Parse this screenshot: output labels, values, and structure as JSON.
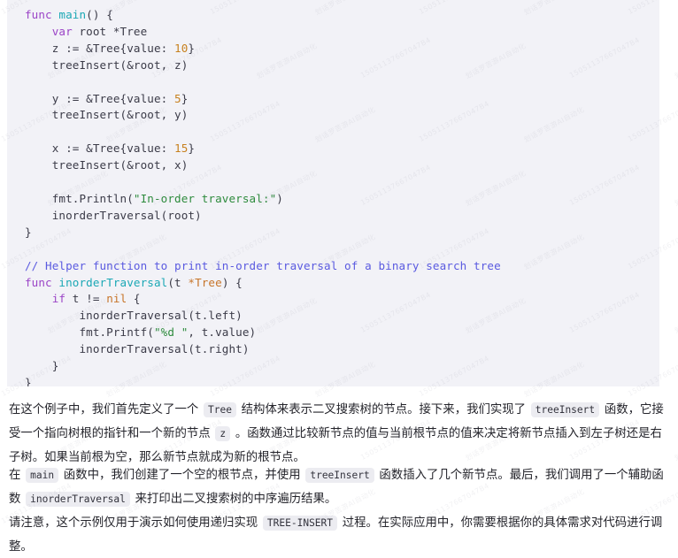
{
  "code_block": {
    "language": "go",
    "background": "#f2f2f7",
    "lines": [
      [
        {
          "t": "func ",
          "c": "kw"
        },
        {
          "t": "main",
          "c": "fn"
        },
        {
          "t": "() {",
          "c": "txt"
        }
      ],
      [
        {
          "t": "    ",
          "c": "txt"
        },
        {
          "t": "var",
          "c": "kw"
        },
        {
          "t": " root *Tree",
          "c": "txt"
        }
      ],
      [
        {
          "t": "    z := &Tree{value: ",
          "c": "txt"
        },
        {
          "t": "10",
          "c": "num"
        },
        {
          "t": "}",
          "c": "txt"
        }
      ],
      [
        {
          "t": "    treeInsert(&root, z)",
          "c": "txt"
        }
      ],
      [
        {
          "t": "",
          "c": "txt"
        }
      ],
      [
        {
          "t": "    y := &Tree{value: ",
          "c": "txt"
        },
        {
          "t": "5",
          "c": "num"
        },
        {
          "t": "}",
          "c": "txt"
        }
      ],
      [
        {
          "t": "    treeInsert(&root, y)",
          "c": "txt"
        }
      ],
      [
        {
          "t": "",
          "c": "txt"
        }
      ],
      [
        {
          "t": "    x := &Tree{value: ",
          "c": "txt"
        },
        {
          "t": "15",
          "c": "num"
        },
        {
          "t": "}",
          "c": "txt"
        }
      ],
      [
        {
          "t": "    treeInsert(&root, x)",
          "c": "txt"
        }
      ],
      [
        {
          "t": "",
          "c": "txt"
        }
      ],
      [
        {
          "t": "    fmt.Println(",
          "c": "txt"
        },
        {
          "t": "\"In-order traversal:\"",
          "c": "str"
        },
        {
          "t": ")",
          "c": "txt"
        }
      ],
      [
        {
          "t": "    inorderTraversal(root)",
          "c": "txt"
        }
      ],
      [
        {
          "t": "}",
          "c": "txt"
        }
      ],
      [
        {
          "t": "",
          "c": "txt"
        }
      ],
      [
        {
          "t": "// Helper function to print in-order traversal of a binary search tree",
          "c": "cmt"
        }
      ],
      [
        {
          "t": "func ",
          "c": "kw"
        },
        {
          "t": "inorderTraversal",
          "c": "fn"
        },
        {
          "t": "(t ",
          "c": "txt"
        },
        {
          "t": "*Tree",
          "c": "type"
        },
        {
          "t": ") {",
          "c": "txt"
        }
      ],
      [
        {
          "t": "    ",
          "c": "txt"
        },
        {
          "t": "if",
          "c": "kw"
        },
        {
          "t": " t != ",
          "c": "txt"
        },
        {
          "t": "nil",
          "c": "type"
        },
        {
          "t": " {",
          "c": "txt"
        }
      ],
      [
        {
          "t": "        inorderTraversal(t.left)",
          "c": "txt"
        }
      ],
      [
        {
          "t": "        fmt.Printf(",
          "c": "txt"
        },
        {
          "t": "\"%d \"",
          "c": "str"
        },
        {
          "t": ", t.value)",
          "c": "txt"
        }
      ],
      [
        {
          "t": "        inorderTraversal(t.right)",
          "c": "txt"
        }
      ],
      [
        {
          "t": "    }",
          "c": "txt"
        }
      ],
      [
        {
          "t": "}",
          "c": "txt"
        }
      ]
    ]
  },
  "paragraphs": [
    {
      "id": "paragraph-1",
      "parts": [
        {
          "type": "text",
          "value": "在这个例子中，我们首先定义了一个 "
        },
        {
          "type": "code",
          "value": "Tree"
        },
        {
          "type": "text",
          "value": " 结构体来表示二叉搜索树的节点。接下来，我们实现了 "
        },
        {
          "type": "code",
          "value": "treeInsert"
        },
        {
          "type": "text",
          "value": " 函数，它接受一个指向树根的指针和一个新的节点 "
        },
        {
          "type": "code",
          "value": "z"
        },
        {
          "type": "text",
          "value": " 。函数通过比较新节点的值与当前根节点的值来决定将新节点插入到左子树还是右子树。如果当前根为空，那么新节点就成为新的根节点。"
        }
      ]
    },
    {
      "id": "paragraph-2",
      "parts": [
        {
          "type": "text",
          "value": "在 "
        },
        {
          "type": "code",
          "value": "main"
        },
        {
          "type": "text",
          "value": " 函数中，我们创建了一个空的根节点，并使用 "
        },
        {
          "type": "code",
          "value": "treeInsert"
        },
        {
          "type": "text",
          "value": " 函数插入了几个新节点。最后，我们调用了一个辅助函数 "
        },
        {
          "type": "code",
          "value": "inorderTraversal"
        },
        {
          "type": "text",
          "value": " 来打印出二叉搜索树的中序遍历结果。"
        }
      ]
    },
    {
      "id": "paragraph-3",
      "parts": [
        {
          "type": "text",
          "value": "请注意，这个示例仅用于演示如何使用递归实现 "
        },
        {
          "type": "code",
          "value": "TREE-INSERT"
        },
        {
          "type": "text",
          "value": " 过程。在实际应用中，你需要根据你的具体需求对代码进行调整。"
        }
      ]
    }
  ],
  "watermarks": [
    "15051137667047B4",
    "划话罗苦游AI自动化"
  ],
  "colors": {
    "code_bg": "#f2f2f7",
    "page_bg": "#ffffff",
    "text": "#24242b",
    "keyword": "#9b44c7",
    "function": "#1ba8b5",
    "type": "#c7752a",
    "number": "#c7811f",
    "string": "#2e8b3d",
    "comment": "#5a5ae0",
    "inline_code_bg": "#ececf1"
  }
}
